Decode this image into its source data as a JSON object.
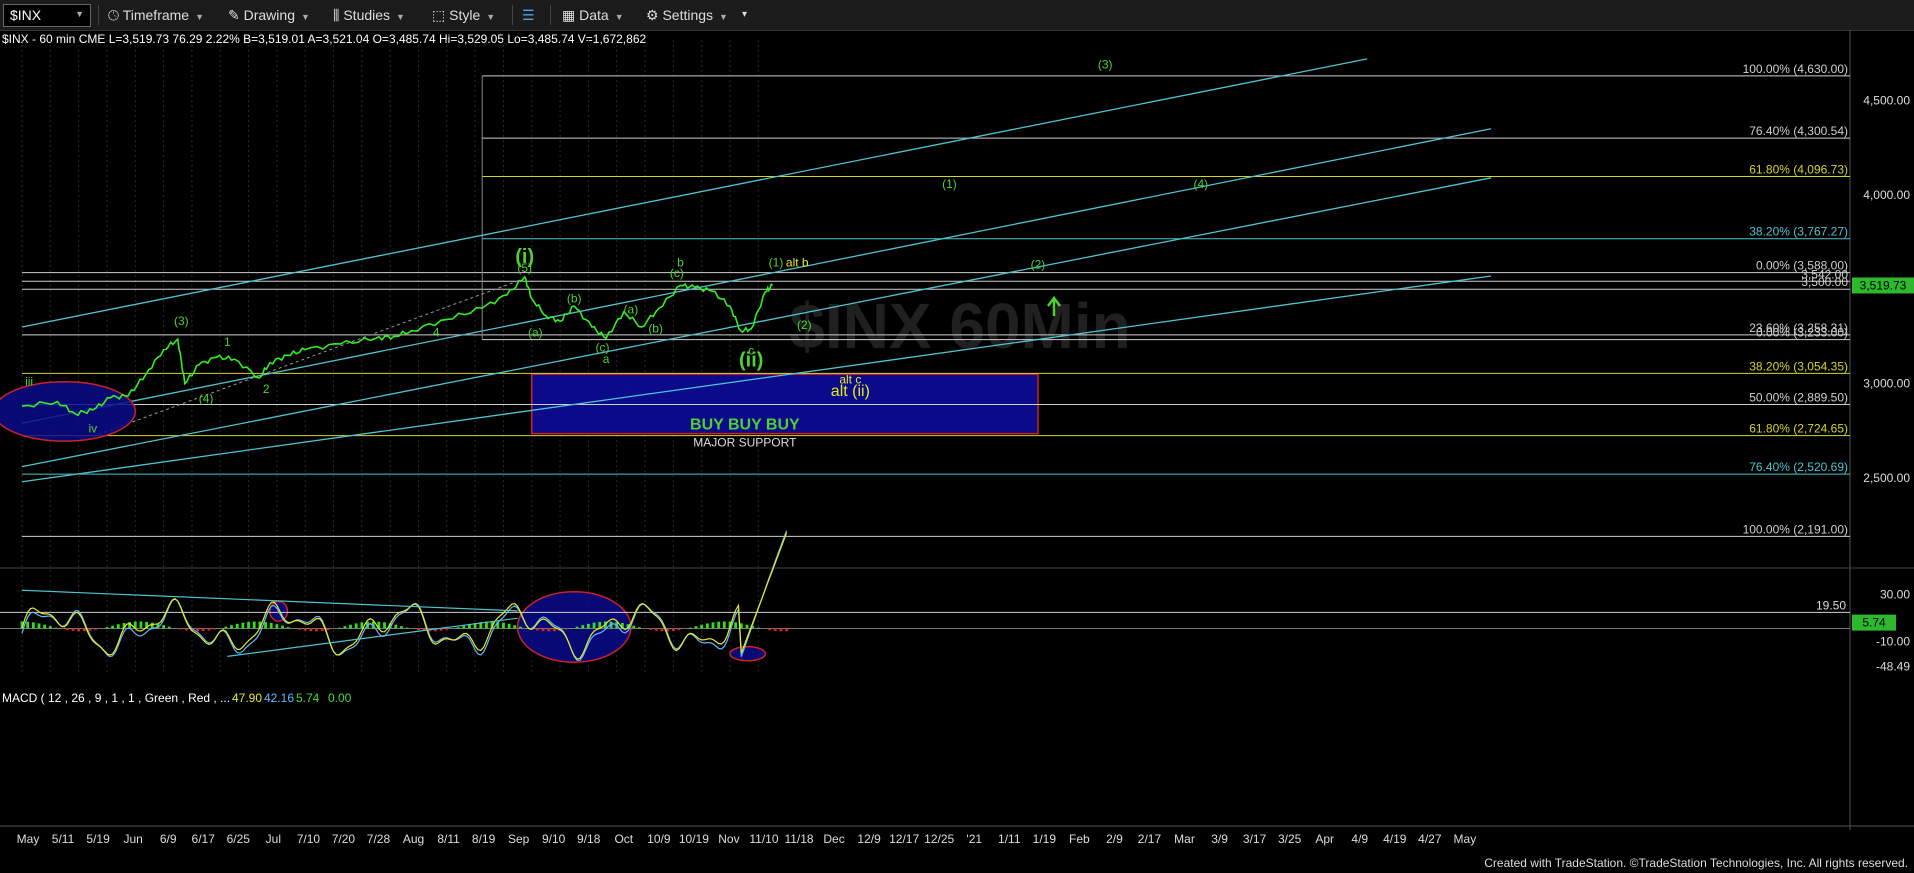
{
  "toolbar": {
    "symbol": "$INX",
    "items": [
      "Timeframe",
      "Drawing",
      "Studies",
      "Style",
      "Data",
      "Settings"
    ]
  },
  "quote": {
    "text": "$INX - 60 min  CME  L=3,519.73  76.29  2.22%  B=3,519.01  A=3,521.04  O=3,485.74  Hi=3,529.05  Lo=3,485.74  V=1,672,862"
  },
  "credit": "Created with TradeStation. ©TradeStation Technologies, Inc. All rights reserved.",
  "colors": {
    "background": "#000000",
    "price": "#33ee22",
    "channel": "#4fc3cf",
    "fib_white": "#cfcfcf",
    "fib_yellow": "#d4d429",
    "wave_green": "#4fd12f",
    "wave_yellow": "#e8e820",
    "buy_box": "#0a0a8a",
    "buy_border": "#cc2222",
    "last_price_box": "#2db82d",
    "macd_pos": "#33dd22",
    "macd_neg": "#dd2222"
  },
  "chart_data": {
    "type": "line",
    "symbol": "$INX",
    "interval": "60 min",
    "price_axis": {
      "ylim": [
        2055,
        4820
      ],
      "ticks": [
        "4,500.00",
        "4,000.00",
        "3,000.00",
        "2,500.00"
      ],
      "last_price": "3,519.73"
    },
    "x_labels": [
      "May",
      "5/11",
      "5/19",
      "Jun",
      "6/9",
      "6/17",
      "6/25",
      "Jul",
      "7/10",
      "7/20",
      "7/28",
      "Aug",
      "8/11",
      "8/19",
      "Sep",
      "9/10",
      "9/18",
      "Oct",
      "10/9",
      "10/19",
      "Nov",
      "11/10",
      "11/18",
      "Dec",
      "12/9",
      "12/17",
      "12/25",
      "'21",
      "1/11",
      "1/19",
      "Feb",
      "2/9",
      "2/17",
      "Mar",
      "3/9",
      "3/17",
      "3/25",
      "Apr",
      "4/9",
      "4/19",
      "4/27",
      "May"
    ],
    "price_series": [
      {
        "x": 0,
        "y": 2880
      },
      {
        "x": 1,
        "y": 2905
      },
      {
        "x": 1.5,
        "y": 2840
      },
      {
        "x": 2,
        "y": 2860
      },
      {
        "x": 2.5,
        "y": 2925
      },
      {
        "x": 3,
        "y": 2935
      },
      {
        "x": 3.5,
        "y": 3050
      },
      {
        "x": 4,
        "y": 3180
      },
      {
        "x": 4.4,
        "y": 3235
      },
      {
        "x": 4.6,
        "y": 3000
      },
      {
        "x": 5,
        "y": 3100
      },
      {
        "x": 5.5,
        "y": 3140
      },
      {
        "x": 6,
        "y": 3130
      },
      {
        "x": 6.7,
        "y": 3030
      },
      {
        "x": 7,
        "y": 3110
      },
      {
        "x": 7.5,
        "y": 3150
      },
      {
        "x": 8,
        "y": 3180
      },
      {
        "x": 9,
        "y": 3210
      },
      {
        "x": 10,
        "y": 3240
      },
      {
        "x": 10.5,
        "y": 3250
      },
      {
        "x": 11,
        "y": 3280
      },
      {
        "x": 12,
        "y": 3340
      },
      {
        "x": 13,
        "y": 3400
      },
      {
        "x": 13.7,
        "y": 3470
      },
      {
        "x": 14.2,
        "y": 3565
      },
      {
        "x": 14.4,
        "y": 3450
      },
      {
        "x": 14.8,
        "y": 3360
      },
      {
        "x": 15.2,
        "y": 3330
      },
      {
        "x": 15.6,
        "y": 3410
      },
      {
        "x": 16.1,
        "y": 3300
      },
      {
        "x": 16.5,
        "y": 3240
      },
      {
        "x": 17,
        "y": 3380
      },
      {
        "x": 17.5,
        "y": 3300
      },
      {
        "x": 18,
        "y": 3400
      },
      {
        "x": 18.6,
        "y": 3520
      },
      {
        "x": 19,
        "y": 3510
      },
      {
        "x": 19.5,
        "y": 3490
      },
      {
        "x": 20,
        "y": 3410
      },
      {
        "x": 20.3,
        "y": 3280
      },
      {
        "x": 20.6,
        "y": 3290
      },
      {
        "x": 21,
        "y": 3485
      },
      {
        "x": 21.2,
        "y": 3520
      }
    ],
    "channel_lines": [
      {
        "name": "upper",
        "points": [
          {
            "x": 0,
            "y": 3300
          },
          {
            "x": 38,
            "y": 4720
          }
        ]
      },
      {
        "name": "middle",
        "points": [
          {
            "x": 0,
            "y": 2790
          },
          {
            "x": 41.5,
            "y": 4350
          }
        ]
      },
      {
        "name": "lower-1",
        "points": [
          {
            "x": 0,
            "y": 2560
          },
          {
            "x": 41.5,
            "y": 4090
          }
        ]
      },
      {
        "name": "lower-2",
        "points": [
          {
            "x": 0,
            "y": 2480
          },
          {
            "x": 41.5,
            "y": 3570
          }
        ]
      }
    ],
    "fib_levels": [
      {
        "pct": "100.00%",
        "value": 4630.0,
        "label": "100.00% (4,630.00)",
        "color": "white",
        "x_start": 13
      },
      {
        "pct": "76.40%",
        "value": 4300.54,
        "label": "76.40% (4,300.54)",
        "color": "white",
        "x_start": 13
      },
      {
        "pct": "61.80%",
        "value": 4096.73,
        "label": "61.80% (4,096.73)",
        "color": "yellow",
        "x_start": 13
      },
      {
        "pct": "38.20%",
        "value": 3767.27,
        "label": "38.20% (3,767.27)",
        "color": "cyan",
        "x_start": 13
      },
      {
        "pct": "0.00%",
        "value": 3588.0,
        "label": "0.00% (3,588.00)",
        "color": "white",
        "x_start": 0
      },
      {
        "pct": "",
        "value": 3542.0,
        "label": "3,542.00",
        "color": "white",
        "x_start": 0
      },
      {
        "pct": "",
        "value": 3500.0,
        "label": "3,500.00",
        "color": "white",
        "x_start": 0
      },
      {
        "pct": "23.60%",
        "value": 3258.31,
        "label": "23.60% (3,258.31)",
        "color": "white",
        "x_start": 0
      },
      {
        "pct": "0.00%",
        "value": 3233.0,
        "label": "0.00% (3,233.00)",
        "color": "white",
        "x_start": 13
      },
      {
        "pct": "38.20%",
        "value": 3054.35,
        "label": "38.20% (3,054.35)",
        "color": "yellow",
        "x_start": 0
      },
      {
        "pct": "50.00%",
        "value": 2889.5,
        "label": "50.00% (2,889.50)",
        "color": "white",
        "x_start": 0
      },
      {
        "pct": "61.80%",
        "value": 2724.65,
        "label": "61.80% (2,724.65)",
        "color": "yellow",
        "x_start": 0
      },
      {
        "pct": "76.40%",
        "value": 2520.69,
        "label": "76.40% (2,520.69)",
        "color": "cyan",
        "x_start": 0
      },
      {
        "pct": "100.00%",
        "value": 2191.0,
        "label": "100.00% (2,191.00)",
        "color": "white",
        "x_start": 0
      }
    ],
    "wave_labels": [
      {
        "text": "(i)",
        "x": 14.2,
        "y": 3640,
        "color": "green",
        "size": "big"
      },
      {
        "text": "(5)",
        "x": 14.2,
        "y": 3590,
        "color": "green"
      },
      {
        "text": "(ii)",
        "x": 20.6,
        "y": 3090,
        "color": "green",
        "size": "big"
      },
      {
        "text": "(3)",
        "x": 4.5,
        "y": 3310,
        "color": "green"
      },
      {
        "text": "1",
        "x": 5.8,
        "y": 3200,
        "color": "green"
      },
      {
        "text": "(4)",
        "x": 5.2,
        "y": 2900,
        "color": "green"
      },
      {
        "text": "2",
        "x": 6.9,
        "y": 2950,
        "color": "green"
      },
      {
        "text": "4",
        "x": 11.7,
        "y": 3250,
        "color": "green"
      },
      {
        "text": "iii",
        "x": 0.2,
        "y": 2990,
        "color": "green"
      },
      {
        "text": "iv",
        "x": 2,
        "y": 2740,
        "color": "green"
      },
      {
        "text": "(a)",
        "x": 14.5,
        "y": 3250,
        "color": "green"
      },
      {
        "text": "(b)",
        "x": 15.6,
        "y": 3430,
        "color": "green"
      },
      {
        "text": "(c)",
        "x": 16.4,
        "y": 3170,
        "color": "green"
      },
      {
        "text": "a",
        "x": 16.5,
        "y": 3110,
        "color": "green"
      },
      {
        "text": "(a)",
        "x": 17.2,
        "y": 3370,
        "color": "green"
      },
      {
        "text": "(b)",
        "x": 17.9,
        "y": 3270,
        "color": "green"
      },
      {
        "text": "b",
        "x": 18.6,
        "y": 3620,
        "color": "green"
      },
      {
        "text": "(c)",
        "x": 18.5,
        "y": 3565,
        "color": "green"
      },
      {
        "text": "c",
        "x": 20.6,
        "y": 3155,
        "color": "green"
      },
      {
        "text": "(1)",
        "x": 21.3,
        "y": 3620,
        "color": "green"
      },
      {
        "text": "alt b",
        "x": 21.9,
        "y": 3620,
        "color": "yellow"
      },
      {
        "text": "(2)",
        "x": 22.1,
        "y": 3290,
        "color": "green"
      },
      {
        "text": "alt c",
        "x": 23.4,
        "y": 3000,
        "color": "yellow"
      },
      {
        "text": "alt (ii)",
        "x": 23.4,
        "y": 2935,
        "color": "yellow",
        "size": "mid"
      },
      {
        "text": "(1)",
        "x": 26.2,
        "y": 4035,
        "color": "green"
      },
      {
        "text": "(2)",
        "x": 28.7,
        "y": 3610,
        "color": "green"
      },
      {
        "text": "(3)",
        "x": 30.6,
        "y": 4670,
        "color": "green"
      },
      {
        "text": "(4)",
        "x": 33.3,
        "y": 4035,
        "color": "green"
      }
    ],
    "buy_zone": {
      "x_start": 14.4,
      "x_end": 28.7,
      "y_top": 3050,
      "y_bottom": 2735,
      "label": "BUY BUY BUY",
      "sublabel": "MAJOR SUPPORT"
    },
    "ellipses": [
      {
        "x_start": -0.8,
        "x_end": 3.2,
        "y_top": 3010,
        "y_bottom": 2695
      },
      {
        "x_start": 14.0,
        "x_end": 17.2,
        "y_top": 1.25,
        "y_bottom": -1.15,
        "panel": "macd"
      },
      {
        "x_start": 20.0,
        "x_end": 21.0,
        "y_top": -0.62,
        "y_bottom": -1.1,
        "panel": "macd"
      },
      {
        "x_start": 7.0,
        "x_end": 7.5,
        "y_top": 0.92,
        "y_bottom": 0.25,
        "panel": "macd"
      }
    ],
    "macd": {
      "title": "MACD ( 12 , 26 , 9 , 1 , 1 , Green , Red , ...",
      "values": [
        "47.90",
        "42.16",
        "5.74",
        "0.00"
      ],
      "ticks": [
        "30.00",
        "-10.00",
        "-48.49"
      ],
      "ref_line": "19.50",
      "last_value": "5.74",
      "ylim": [
        -1.55,
        1.65
      ]
    }
  }
}
